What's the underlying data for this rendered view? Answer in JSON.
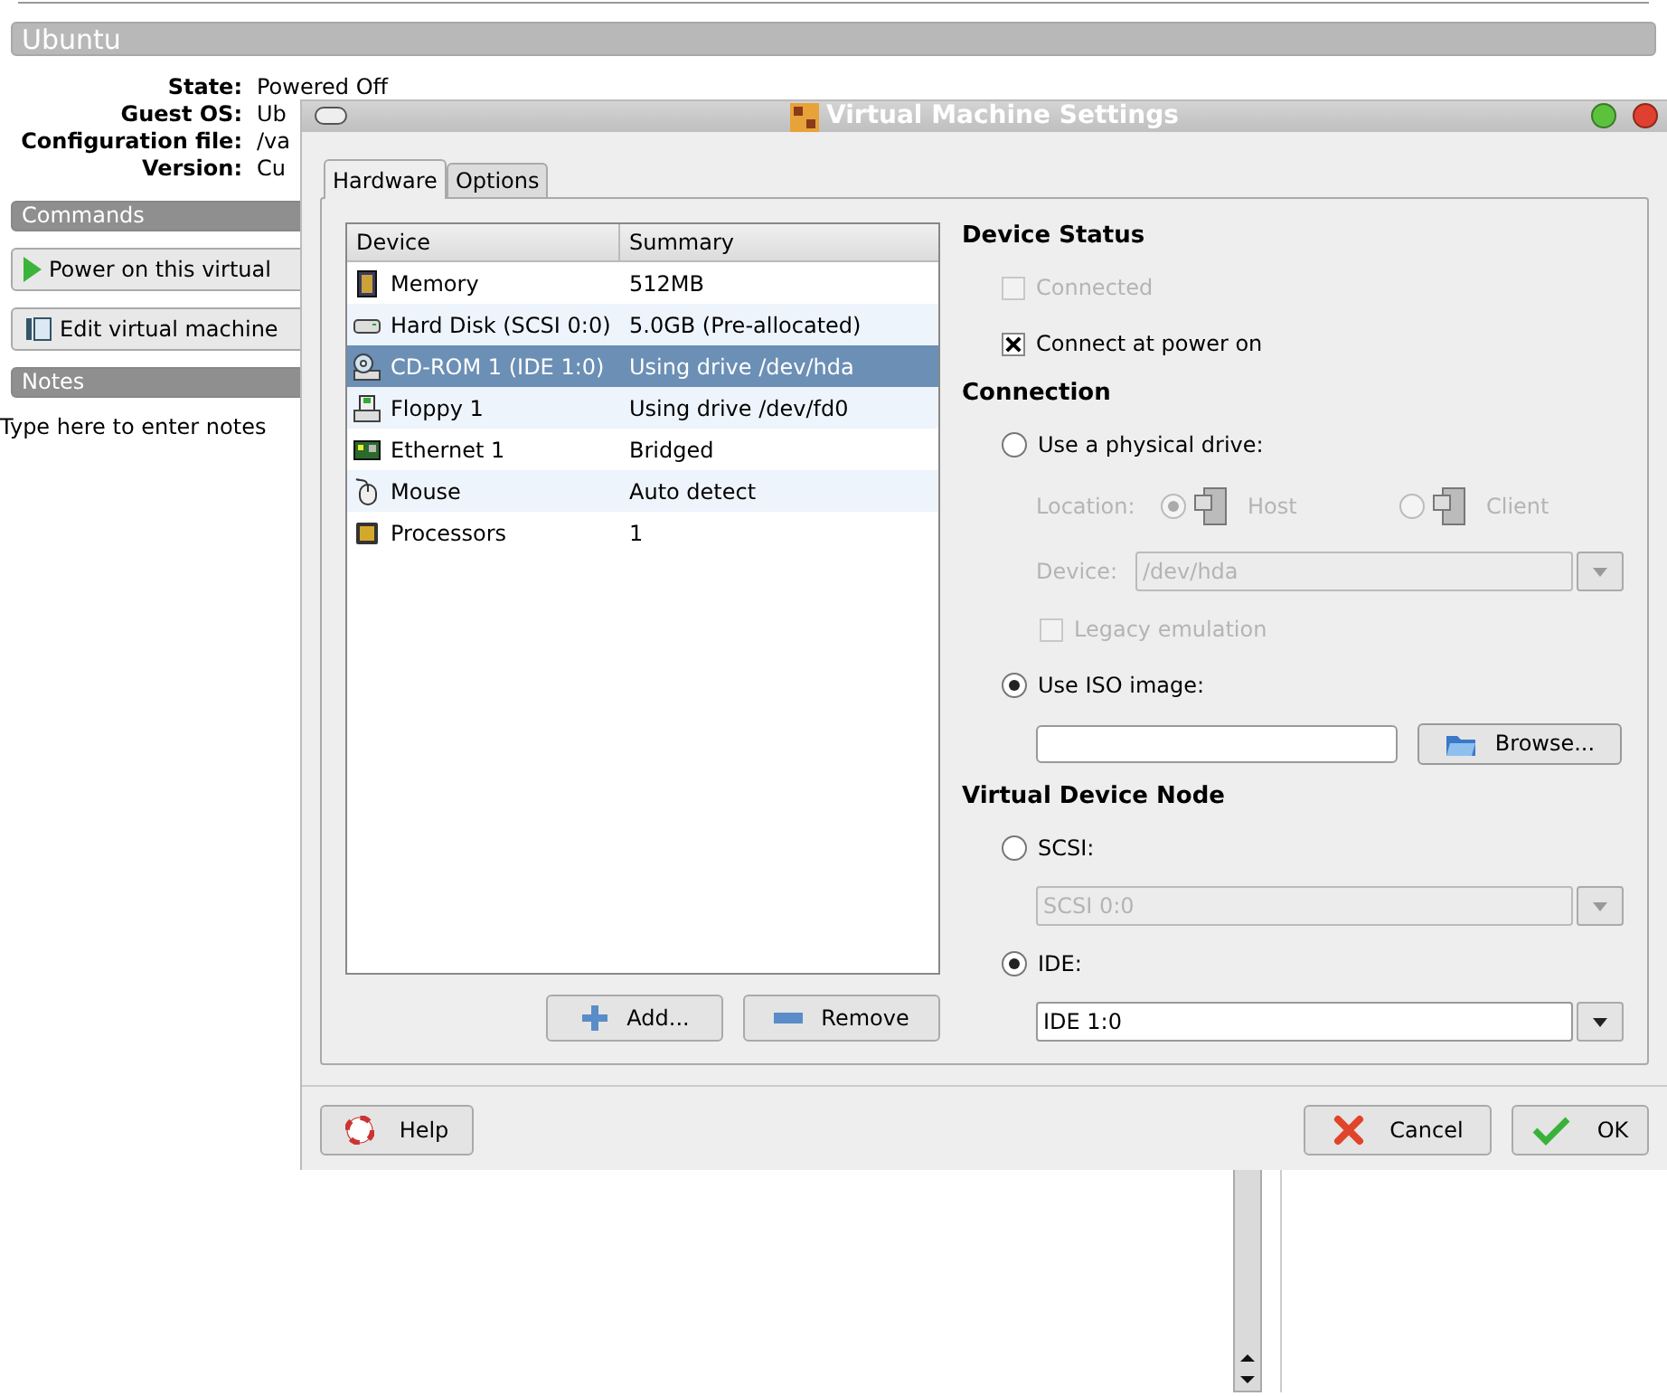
{
  "vm": {
    "name": "Ubuntu",
    "info": [
      {
        "label": "State:",
        "value": "Powered Off"
      },
      {
        "label": "Guest OS:",
        "value": "Ub"
      },
      {
        "label": "Configuration file:",
        "value": "/va"
      },
      {
        "label": "Version:",
        "value": "Cu"
      }
    ],
    "commands_header": "Commands",
    "commands": [
      {
        "kind": "power",
        "label": "Power on this virtual"
      },
      {
        "kind": "edit",
        "label": "Edit virtual machine"
      }
    ],
    "notes_header": "Notes",
    "notes_placeholder": "Type here to enter notes"
  },
  "dialog": {
    "title": "Virtual Machine Settings",
    "tabs": [
      {
        "label": "Hardware",
        "selected": true
      },
      {
        "label": "Options",
        "selected": false
      }
    ],
    "devices": {
      "columns": [
        "Device",
        "Summary"
      ],
      "rows": [
        {
          "kind": "memory",
          "device": "Memory",
          "summary": "512MB",
          "selected": false
        },
        {
          "kind": "disk",
          "device": "Hard Disk (SCSI 0:0)",
          "summary": "5.0GB (Pre-allocated)",
          "selected": false
        },
        {
          "kind": "cdrom",
          "device": "CD-ROM 1 (IDE 1:0)",
          "summary": "Using drive /dev/hda",
          "selected": true
        },
        {
          "kind": "floppy",
          "device": "Floppy 1",
          "summary": "Using drive /dev/fd0",
          "selected": false
        },
        {
          "kind": "ethernet",
          "device": "Ethernet 1",
          "summary": "Bridged",
          "selected": false
        },
        {
          "kind": "mouse",
          "device": "Mouse",
          "summary": "Auto detect",
          "selected": false
        },
        {
          "kind": "cpu",
          "device": "Processors",
          "summary": "1",
          "selected": false
        }
      ]
    },
    "add": "Add...",
    "remove": "Remove",
    "device_status": {
      "title": "Device Status",
      "options": [
        {
          "label": "Connected",
          "checked": false,
          "disabled": true
        },
        {
          "label": "Connect at power on",
          "checked": true,
          "disabled": false
        }
      ]
    },
    "connection": {
      "title": "Connection",
      "physical": {
        "label": "Use a physical drive:",
        "selected": false
      },
      "location_label": "Location:",
      "locations": [
        {
          "label": "Host",
          "selected": true
        },
        {
          "label": "Client",
          "selected": false
        }
      ],
      "device_label": "Device:",
      "device_value": "/dev/hda",
      "legacy": {
        "label": "Legacy emulation",
        "checked": false
      },
      "iso": {
        "label": "Use ISO image:",
        "selected": true
      },
      "browse": "Browse..."
    },
    "node": {
      "title": "Virtual Device Node",
      "options": [
        {
          "label": "SCSI:",
          "selected": false,
          "value": "SCSI 0:0"
        },
        {
          "label": "IDE:",
          "selected": true,
          "value": "IDE 1:0"
        }
      ]
    },
    "buttons": [
      {
        "kind": "help",
        "label": "Help"
      },
      {
        "kind": "cancel",
        "label": "Cancel"
      },
      {
        "kind": "ok",
        "label": "OK"
      }
    ]
  }
}
